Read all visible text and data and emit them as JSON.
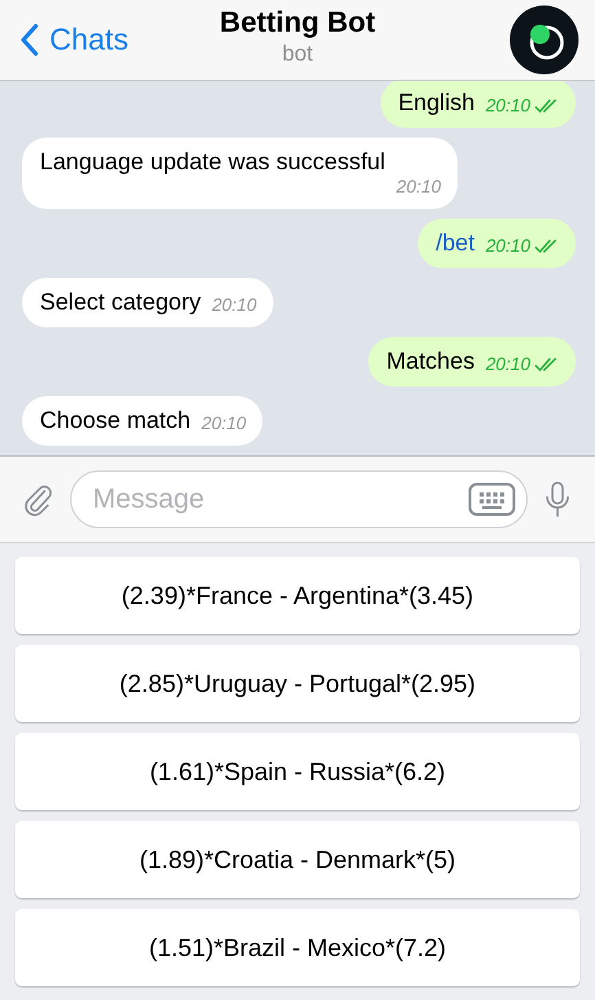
{
  "header": {
    "back_label": "Chats",
    "title": "Betting Bot",
    "subtitle": "bot"
  },
  "messages": [
    {
      "kind": "out",
      "text": "English",
      "time": "20:10",
      "read": true,
      "command": false
    },
    {
      "kind": "in",
      "text": "Language update was successful",
      "time": "20:10",
      "read": false,
      "command": false
    },
    {
      "kind": "out",
      "text": "/bet",
      "time": "20:10",
      "read": true,
      "command": true
    },
    {
      "kind": "in",
      "text": "Select category",
      "time": "20:10",
      "read": false,
      "command": false
    },
    {
      "kind": "out",
      "text": "Matches",
      "time": "20:10",
      "read": true,
      "command": false
    },
    {
      "kind": "in",
      "text": "Choose match",
      "time": "20:10",
      "read": false,
      "command": false
    }
  ],
  "composer": {
    "placeholder": "Message"
  },
  "keyboard_buttons": [
    "(2.39)*France - Argentina*(3.45)",
    "(2.85)*Uruguay - Portugal*(2.95)",
    "(1.61)*Spain - Russia*(6.2)",
    "(1.89)*Croatia - Denmark*(5)",
    "(1.51)*Brazil - Mexico*(7.2)"
  ]
}
